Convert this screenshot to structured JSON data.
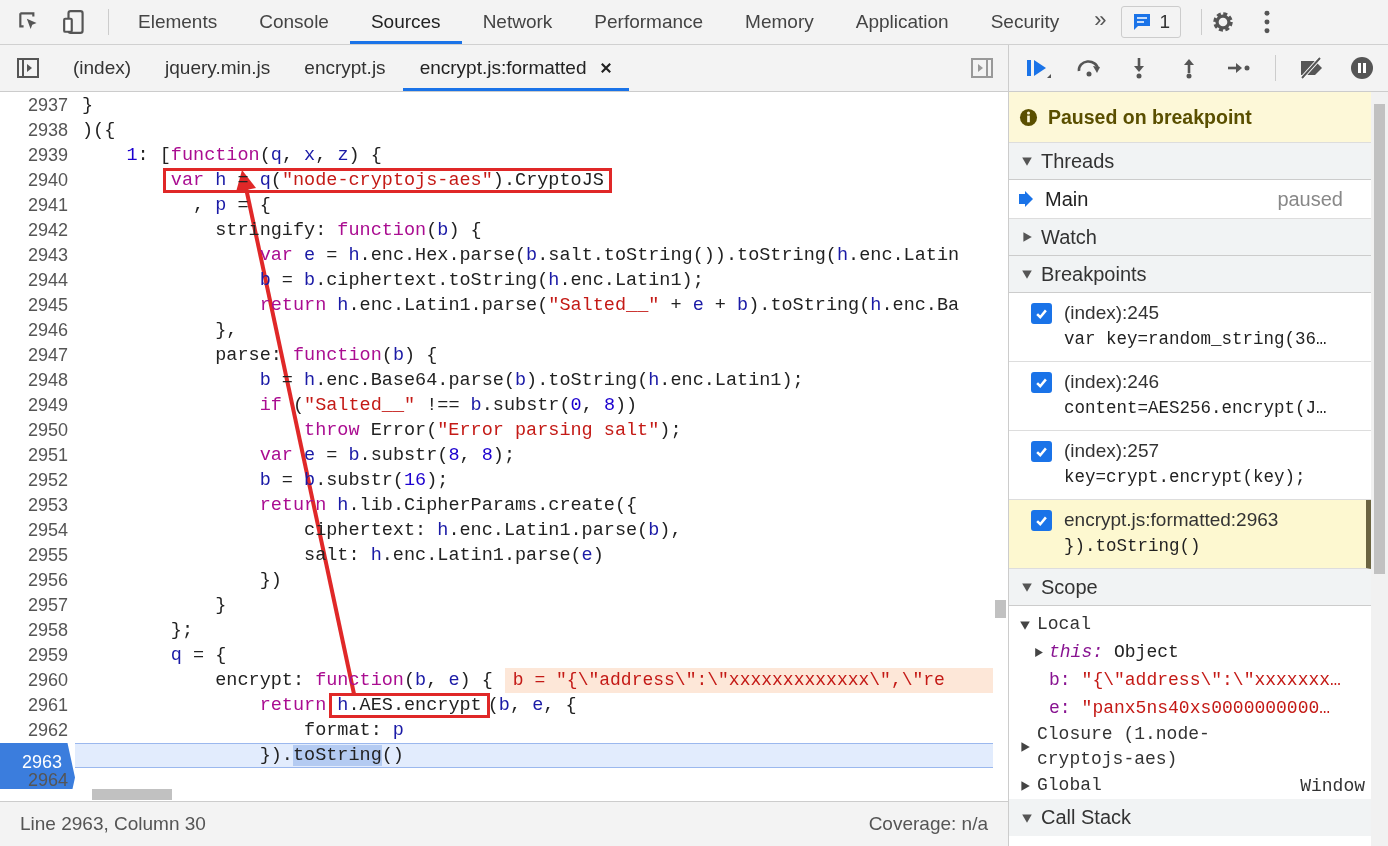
{
  "toolbar": {
    "tabs": [
      {
        "label": "Elements",
        "selected": false
      },
      {
        "label": "Console",
        "selected": false
      },
      {
        "label": "Sources",
        "selected": true
      },
      {
        "label": "Network",
        "selected": false
      },
      {
        "label": "Performance",
        "selected": false
      },
      {
        "label": "Memory",
        "selected": false
      },
      {
        "label": "Application",
        "selected": false
      },
      {
        "label": "Security",
        "selected": false
      }
    ],
    "more": "»",
    "issues_count": "1"
  },
  "file_tabs": [
    {
      "label": "(index)",
      "selected": false,
      "closable": false
    },
    {
      "label": "jquery.min.js",
      "selected": false,
      "closable": false
    },
    {
      "label": "encrypt.js",
      "selected": false,
      "closable": false
    },
    {
      "label": "encrypt.js:formatted",
      "selected": true,
      "closable": true
    }
  ],
  "editor": {
    "lines": [
      {
        "number": "2937",
        "current": false,
        "breakpoint": false,
        "tokens": [
          {
            "kind": "plain",
            "text": "}"
          }
        ]
      },
      {
        "number": "2938",
        "current": false,
        "breakpoint": false,
        "tokens": [
          {
            "kind": "plain",
            "text": ")({"
          }
        ]
      },
      {
        "number": "2939",
        "current": false,
        "breakpoint": false,
        "tokens": [
          {
            "kind": "number",
            "text": "    1"
          },
          {
            "kind": "plain",
            "text": ": ["
          },
          {
            "kind": "keyword",
            "text": "function"
          },
          {
            "kind": "plain",
            "text": "("
          },
          {
            "kind": "variable",
            "text": "q"
          },
          {
            "kind": "plain",
            "text": ", "
          },
          {
            "kind": "variable",
            "text": "x"
          },
          {
            "kind": "plain",
            "text": ", "
          },
          {
            "kind": "variable",
            "text": "z"
          },
          {
            "kind": "plain",
            "text": ") {"
          }
        ]
      },
      {
        "number": "2940",
        "current": false,
        "breakpoint": false,
        "tokens": [
          {
            "kind": "boxed",
            "tokens": [
              {
                "kind": "keyword",
                "text": "        var"
              },
              {
                "kind": "variable",
                "text": " h"
              },
              {
                "kind": "plain",
                "text": " = "
              },
              {
                "kind": "variable",
                "text": "q"
              },
              {
                "kind": "plain",
                "text": "("
              },
              {
                "kind": "string",
                "text": "\"node-cryptojs-aes\""
              },
              {
                "kind": "plain",
                "text": ").CryptoJS"
              }
            ]
          }
        ]
      },
      {
        "number": "2941",
        "current": false,
        "breakpoint": false,
        "tokens": [
          {
            "kind": "plain",
            "text": "          , "
          },
          {
            "kind": "variable",
            "text": "p"
          },
          {
            "kind": "plain",
            "text": " = {"
          }
        ]
      },
      {
        "number": "2942",
        "current": false,
        "breakpoint": false,
        "tokens": [
          {
            "kind": "plain",
            "text": "            stringify: "
          },
          {
            "kind": "keyword",
            "text": "function"
          },
          {
            "kind": "plain",
            "text": "("
          },
          {
            "kind": "variable",
            "text": "b"
          },
          {
            "kind": "plain",
            "text": ") {"
          }
        ]
      },
      {
        "number": "2943",
        "current": false,
        "breakpoint": false,
        "tokens": [
          {
            "kind": "keyword",
            "text": "                var"
          },
          {
            "kind": "variable",
            "text": " e"
          },
          {
            "kind": "plain",
            "text": " = "
          },
          {
            "kind": "variable",
            "text": "h"
          },
          {
            "kind": "plain",
            "text": ".enc.Hex.parse("
          },
          {
            "kind": "variable",
            "text": "b"
          },
          {
            "kind": "plain",
            "text": ".salt.toString()).toString("
          },
          {
            "kind": "variable",
            "text": "h"
          },
          {
            "kind": "plain",
            "text": ".enc.Latin"
          }
        ]
      },
      {
        "number": "2944",
        "current": false,
        "breakpoint": false,
        "tokens": [
          {
            "kind": "variable",
            "text": "                b"
          },
          {
            "kind": "plain",
            "text": " = "
          },
          {
            "kind": "variable",
            "text": "b"
          },
          {
            "kind": "plain",
            "text": ".ciphertext.toString("
          },
          {
            "kind": "variable",
            "text": "h"
          },
          {
            "kind": "plain",
            "text": ".enc.Latin1);"
          }
        ]
      },
      {
        "number": "2945",
        "current": false,
        "breakpoint": false,
        "tokens": [
          {
            "kind": "keyword",
            "text": "                return"
          },
          {
            "kind": "variable",
            "text": " h"
          },
          {
            "kind": "plain",
            "text": ".enc.Latin1.parse("
          },
          {
            "kind": "string",
            "text": "\"Salted__\""
          },
          {
            "kind": "plain",
            "text": " + "
          },
          {
            "kind": "variable",
            "text": "e"
          },
          {
            "kind": "plain",
            "text": " + "
          },
          {
            "kind": "variable",
            "text": "b"
          },
          {
            "kind": "plain",
            "text": ").toString("
          },
          {
            "kind": "variable",
            "text": "h"
          },
          {
            "kind": "plain",
            "text": ".enc.Ba"
          }
        ]
      },
      {
        "number": "2946",
        "current": false,
        "breakpoint": false,
        "tokens": [
          {
            "kind": "plain",
            "text": "            },"
          }
        ]
      },
      {
        "number": "2947",
        "current": false,
        "breakpoint": false,
        "tokens": [
          {
            "kind": "plain",
            "text": "            parse: "
          },
          {
            "kind": "keyword",
            "text": "function"
          },
          {
            "kind": "plain",
            "text": "("
          },
          {
            "kind": "variable",
            "text": "b"
          },
          {
            "kind": "plain",
            "text": ") {"
          }
        ]
      },
      {
        "number": "2948",
        "current": false,
        "breakpoint": false,
        "tokens": [
          {
            "kind": "variable",
            "text": "                b"
          },
          {
            "kind": "plain",
            "text": " = "
          },
          {
            "kind": "variable",
            "text": "h"
          },
          {
            "kind": "plain",
            "text": ".enc.Base64.parse("
          },
          {
            "kind": "variable",
            "text": "b"
          },
          {
            "kind": "plain",
            "text": ").toString("
          },
          {
            "kind": "variable",
            "text": "h"
          },
          {
            "kind": "plain",
            "text": ".enc.Latin1);"
          }
        ]
      },
      {
        "number": "2949",
        "current": false,
        "breakpoint": false,
        "tokens": [
          {
            "kind": "keyword",
            "text": "                if"
          },
          {
            "kind": "plain",
            "text": " ("
          },
          {
            "kind": "string",
            "text": "\"Salted__\""
          },
          {
            "kind": "plain",
            "text": " !== "
          },
          {
            "kind": "variable",
            "text": "b"
          },
          {
            "kind": "plain",
            "text": ".substr("
          },
          {
            "kind": "number",
            "text": "0"
          },
          {
            "kind": "plain",
            "text": ", "
          },
          {
            "kind": "number",
            "text": "8"
          },
          {
            "kind": "plain",
            "text": "))"
          }
        ]
      },
      {
        "number": "2950",
        "current": false,
        "breakpoint": false,
        "tokens": [
          {
            "kind": "keyword",
            "text": "                    throw"
          },
          {
            "kind": "plain",
            "text": " Error("
          },
          {
            "kind": "string",
            "text": "\"Error parsing salt\""
          },
          {
            "kind": "plain",
            "text": ");"
          }
        ]
      },
      {
        "number": "2951",
        "current": false,
        "breakpoint": false,
        "tokens": [
          {
            "kind": "keyword",
            "text": "                var"
          },
          {
            "kind": "variable",
            "text": " e"
          },
          {
            "kind": "plain",
            "text": " = "
          },
          {
            "kind": "variable",
            "text": "b"
          },
          {
            "kind": "plain",
            "text": ".substr("
          },
          {
            "kind": "number",
            "text": "8"
          },
          {
            "kind": "plain",
            "text": ", "
          },
          {
            "kind": "number",
            "text": "8"
          },
          {
            "kind": "plain",
            "text": ");"
          }
        ]
      },
      {
        "number": "2952",
        "current": false,
        "breakpoint": false,
        "tokens": [
          {
            "kind": "variable",
            "text": "                b"
          },
          {
            "kind": "plain",
            "text": " = "
          },
          {
            "kind": "variable",
            "text": "b"
          },
          {
            "kind": "plain",
            "text": ".substr("
          },
          {
            "kind": "number",
            "text": "16"
          },
          {
            "kind": "plain",
            "text": ");"
          }
        ]
      },
      {
        "number": "2953",
        "current": false,
        "breakpoint": false,
        "tokens": [
          {
            "kind": "keyword",
            "text": "                return"
          },
          {
            "kind": "variable",
            "text": " h"
          },
          {
            "kind": "plain",
            "text": ".lib.CipherParams.create({"
          }
        ]
      },
      {
        "number": "2954",
        "current": false,
        "breakpoint": false,
        "tokens": [
          {
            "kind": "plain",
            "text": "                    ciphertext: "
          },
          {
            "kind": "variable",
            "text": "h"
          },
          {
            "kind": "plain",
            "text": ".enc.Latin1.parse("
          },
          {
            "kind": "variable",
            "text": "b"
          },
          {
            "kind": "plain",
            "text": "),"
          }
        ]
      },
      {
        "number": "2955",
        "current": false,
        "breakpoint": false,
        "tokens": [
          {
            "kind": "plain",
            "text": "                    salt: "
          },
          {
            "kind": "variable",
            "text": "h"
          },
          {
            "kind": "plain",
            "text": ".enc.Latin1.parse("
          },
          {
            "kind": "variable",
            "text": "e"
          },
          {
            "kind": "plain",
            "text": ")"
          }
        ]
      },
      {
        "number": "2956",
        "current": false,
        "breakpoint": false,
        "tokens": [
          {
            "kind": "plain",
            "text": "                })"
          }
        ]
      },
      {
        "number": "2957",
        "current": false,
        "breakpoint": false,
        "tokens": [
          {
            "kind": "plain",
            "text": "            }"
          }
        ]
      },
      {
        "number": "2958",
        "current": false,
        "breakpoint": false,
        "tokens": [
          {
            "kind": "plain",
            "text": "        };"
          }
        ]
      },
      {
        "number": "2959",
        "current": false,
        "breakpoint": false,
        "tokens": [
          {
            "kind": "variable",
            "text": "        q"
          },
          {
            "kind": "plain",
            "text": " = {"
          }
        ]
      },
      {
        "number": "2960",
        "current": false,
        "breakpoint": false,
        "inline_value": "b = \"{\\\"address\\\":\\\"xxxxxxxxxxxxx\\\",\\\"re",
        "tokens": [
          {
            "kind": "plain",
            "text": "            encrypt: "
          },
          {
            "kind": "keyword",
            "text": "function"
          },
          {
            "kind": "plain",
            "text": "("
          },
          {
            "kind": "variable",
            "text": "b"
          },
          {
            "kind": "plain",
            "text": ", "
          },
          {
            "kind": "variable",
            "text": "e"
          },
          {
            "kind": "plain",
            "text": ") {"
          }
        ]
      },
      {
        "number": "2961",
        "current": false,
        "breakpoint": false,
        "tokens": [
          {
            "kind": "keyword",
            "text": "                return"
          },
          {
            "kind": "boxed",
            "tokens": [
              {
                "kind": "variable",
                "text": " h"
              },
              {
                "kind": "plain",
                "text": ".AES.encrypt"
              }
            ]
          },
          {
            "kind": "plain",
            "text": "("
          },
          {
            "kind": "variable",
            "text": "b"
          },
          {
            "kind": "plain",
            "text": ", "
          },
          {
            "kind": "variable",
            "text": "e"
          },
          {
            "kind": "plain",
            "text": ", {"
          }
        ]
      },
      {
        "number": "2962",
        "current": false,
        "breakpoint": false,
        "tokens": [
          {
            "kind": "plain",
            "text": "                    format: "
          },
          {
            "kind": "variable",
            "text": "p"
          }
        ]
      },
      {
        "number": "2963",
        "current": true,
        "breakpoint": true,
        "tokens": [
          {
            "kind": "plain",
            "text": "                })."
          },
          {
            "kind": "selection",
            "text": "toString"
          },
          {
            "kind": "plain",
            "text": "()"
          }
        ]
      },
      {
        "number": "2964",
        "current": false,
        "breakpoint": false
      }
    ]
  },
  "status_bar": {
    "position": "Line 2963, Column 30",
    "coverage": "Coverage: n/a"
  },
  "debugger": {
    "banner": "Paused on breakpoint",
    "sections": [
      {
        "kind": "threads",
        "title": "Threads",
        "expanded": true,
        "threads": [
          {
            "name": "Main",
            "status": "paused",
            "selected": true
          }
        ]
      },
      {
        "kind": "watch",
        "title": "Watch",
        "expanded": false
      },
      {
        "kind": "breakpoints",
        "title": "Breakpoints",
        "expanded": true,
        "items": [
          {
            "location": "(index):245",
            "code": "var key=random_string(36…",
            "checked": true,
            "selected": false
          },
          {
            "location": "(index):246",
            "code": "content=AES256.encrypt(J…",
            "checked": true,
            "selected": false
          },
          {
            "location": "(index):257",
            "code": "key=crypt.encrypt(key);",
            "checked": true,
            "selected": false
          },
          {
            "location": "encrypt.js:formatted:2963",
            "code": "}).toString()",
            "checked": true,
            "selected": true
          }
        ]
      },
      {
        "kind": "scope",
        "title": "Scope",
        "expanded": true,
        "scopes": [
          {
            "name": "Local",
            "expanded": true,
            "entries": [
              {
                "key": "this:",
                "value": "Object",
                "kind": "object"
              },
              {
                "key": "b:",
                "value": "\"{\\\"address\\\":\\\"xxxxxxx…",
                "kind": "string"
              },
              {
                "key": "e:",
                "value": "\"panx5ns40xs0000000000…",
                "kind": "string"
              }
            ]
          },
          {
            "name": "Closure (1.node-cryptojs-aes)",
            "expanded": false
          },
          {
            "name": "Global",
            "expanded": false,
            "value": "Window"
          }
        ]
      },
      {
        "kind": "callstack",
        "title": "Call Stack",
        "expanded": true
      }
    ]
  }
}
